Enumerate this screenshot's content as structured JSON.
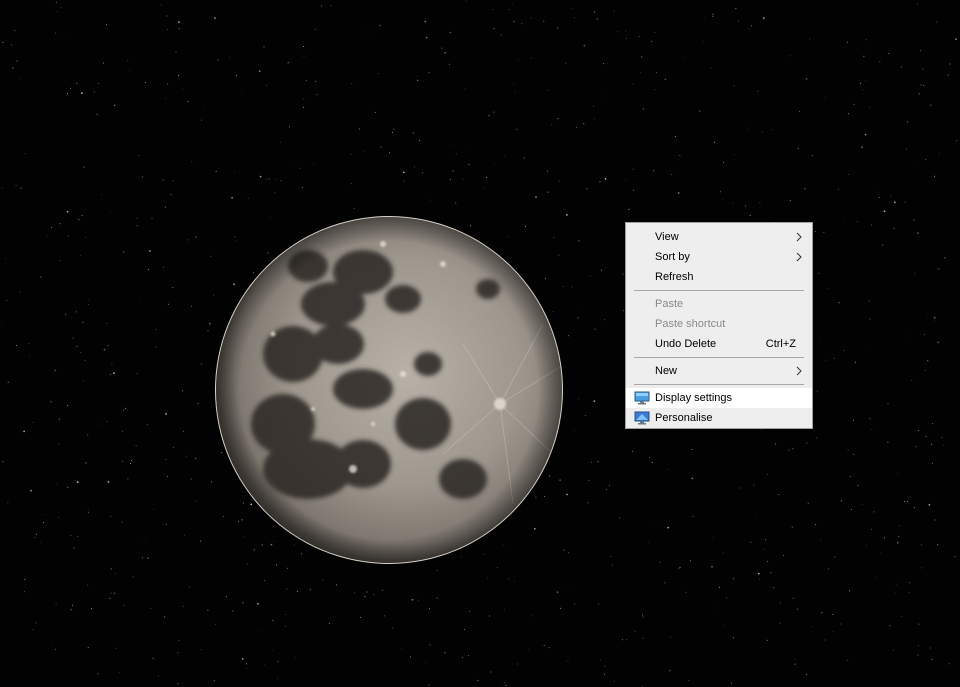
{
  "desktop": {
    "wallpaper": "full-moon-photo",
    "background_color": "#020202"
  },
  "context_menu": {
    "view_label": "View",
    "sort_by_label": "Sort by",
    "refresh_label": "Refresh",
    "paste_label": "Paste",
    "paste_shortcut_label": "Paste shortcut",
    "undo_delete_label": "Undo Delete",
    "undo_delete_shortcut": "Ctrl+Z",
    "new_label": "New",
    "display_settings_label": "Display settings",
    "personalise_label": "Personalise",
    "highlighted_item": "Display settings",
    "disabled_items": [
      "Paste",
      "Paste shortcut"
    ],
    "icons": {
      "display_settings": "monitor-icon",
      "personalise": "personalise-monitor-icon",
      "submenu": "chevron-right-icon"
    }
  }
}
